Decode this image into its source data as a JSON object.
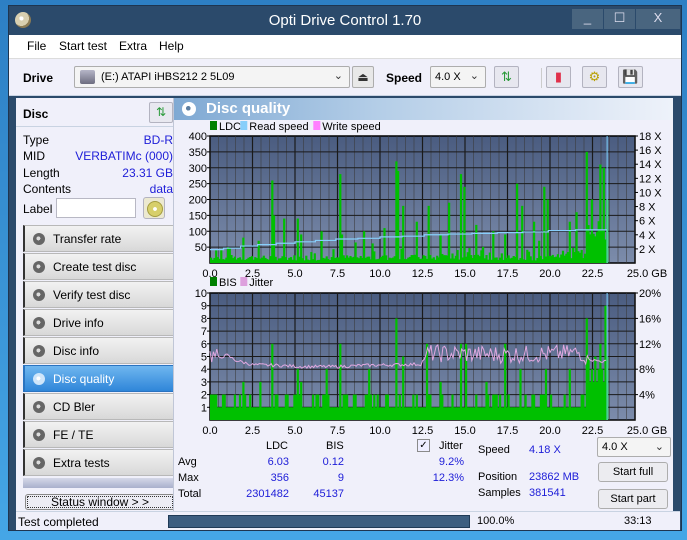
{
  "window": {
    "title": "Opti Drive Control 1.70",
    "controls": [
      "_",
      "☐",
      "X"
    ]
  },
  "menu": [
    {
      "label": "File",
      "accel": "F"
    },
    {
      "label": "Start test",
      "accel": "S"
    },
    {
      "label": "Extra",
      "accel": "x"
    },
    {
      "label": "Help",
      "accel": "H"
    }
  ],
  "toolbar": {
    "drive_label": "Drive",
    "drive_value": "(E:)  ATAPI iHBS212  2 5L09",
    "speed_label": "Speed",
    "speed_value": "4.0 X",
    "icons": [
      "refresh-icon",
      "eraser-icon",
      "settings-icon",
      "save-icon"
    ]
  },
  "disc": {
    "title": "Disc",
    "rows": [
      {
        "key": "Type",
        "value": "BD-R"
      },
      {
        "key": "MID",
        "value": "VERBATIMc (000)"
      },
      {
        "key": "Length",
        "value": "23.31 GB"
      },
      {
        "key": "Contents",
        "value": "data"
      }
    ],
    "label_key": "Label",
    "label_value": ""
  },
  "nav": [
    {
      "label": "Transfer rate",
      "active": false
    },
    {
      "label": "Create test disc",
      "active": false
    },
    {
      "label": "Verify test disc",
      "active": false
    },
    {
      "label": "Drive info",
      "active": false
    },
    {
      "label": "Disc info",
      "active": false
    },
    {
      "label": "Disc quality",
      "active": true
    },
    {
      "label": "CD Bler",
      "active": false
    },
    {
      "label": "FE / TE",
      "active": false
    },
    {
      "label": "Extra tests",
      "active": false
    }
  ],
  "status_window_button": "Status window > >",
  "panel_title": "Disc quality",
  "chart_data": [
    {
      "type": "bar",
      "title": "LDC",
      "legend": [
        "LDC",
        "Read speed",
        "Write speed"
      ],
      "legend_colors": {
        "LDC": "#008000",
        "Read speed": "#87cefa",
        "Write speed": "#ff80ff"
      },
      "xlabel": "GB",
      "x_ticks": [
        "0.0",
        "2.5",
        "5.0",
        "7.5",
        "10.0",
        "12.5",
        "15.0",
        "17.5",
        "20.0",
        "22.5",
        "25.0 GB"
      ],
      "xlim": [
        0,
        25
      ],
      "y_ticks_left": [
        "400",
        "350",
        "300",
        "250",
        "200",
        "150",
        "100",
        "50"
      ],
      "ylim_left": [
        0,
        400
      ],
      "y_ticks_right": [
        "18 X",
        "16 X",
        "14 X",
        "12 X",
        "10 X",
        "8 X",
        "6 X",
        "4 X",
        "2 X"
      ],
      "ylim_right": [
        0,
        18
      ],
      "ldc_peaks": [
        {
          "x": 0.3,
          "y": 40
        },
        {
          "x": 1.0,
          "y": 50
        },
        {
          "x": 1.9,
          "y": 80
        },
        {
          "x": 2.8,
          "y": 70
        },
        {
          "x": 3.6,
          "y": 260
        },
        {
          "x": 3.7,
          "y": 150
        },
        {
          "x": 4.3,
          "y": 140
        },
        {
          "x": 5.1,
          "y": 140
        },
        {
          "x": 5.3,
          "y": 90
        },
        {
          "x": 6.5,
          "y": 100
        },
        {
          "x": 7.6,
          "y": 280
        },
        {
          "x": 7.7,
          "y": 90
        },
        {
          "x": 9.0,
          "y": 100
        },
        {
          "x": 10.2,
          "y": 110
        },
        {
          "x": 10.9,
          "y": 320
        },
        {
          "x": 11.0,
          "y": 290
        },
        {
          "x": 11.3,
          "y": 180
        },
        {
          "x": 12.1,
          "y": 130
        },
        {
          "x": 12.8,
          "y": 180
        },
        {
          "x": 13.5,
          "y": 90
        },
        {
          "x": 14.0,
          "y": 190
        },
        {
          "x": 14.7,
          "y": 280
        },
        {
          "x": 14.9,
          "y": 240
        },
        {
          "x": 15.6,
          "y": 120
        },
        {
          "x": 16.6,
          "y": 100
        },
        {
          "x": 17.3,
          "y": 90
        },
        {
          "x": 18.0,
          "y": 250
        },
        {
          "x": 18.3,
          "y": 180
        },
        {
          "x": 19.0,
          "y": 130
        },
        {
          "x": 19.6,
          "y": 240
        },
        {
          "x": 19.8,
          "y": 200
        },
        {
          "x": 21.1,
          "y": 130
        },
        {
          "x": 21.5,
          "y": 160
        },
        {
          "x": 22.1,
          "y": 350
        },
        {
          "x": 22.4,
          "y": 200
        },
        {
          "x": 22.9,
          "y": 310
        },
        {
          "x": 23.1,
          "y": 300
        },
        {
          "x": 23.3,
          "y": 200
        }
      ],
      "read_speed": [
        {
          "x": 0.0,
          "y": 1.9
        },
        {
          "x": 0.8,
          "y": 2.1
        },
        {
          "x": 1.8,
          "y": 2.4
        },
        {
          "x": 2.8,
          "y": 2.6
        },
        {
          "x": 3.9,
          "y": 2.8
        },
        {
          "x": 5.0,
          "y": 3.0
        },
        {
          "x": 6.2,
          "y": 3.2
        },
        {
          "x": 7.4,
          "y": 3.4
        },
        {
          "x": 8.7,
          "y": 3.5
        },
        {
          "x": 10.0,
          "y": 3.7
        },
        {
          "x": 11.3,
          "y": 3.8
        },
        {
          "x": 12.6,
          "y": 4.0
        },
        {
          "x": 14.0,
          "y": 4.1
        },
        {
          "x": 15.4,
          "y": 4.2
        },
        {
          "x": 16.9,
          "y": 4.3
        },
        {
          "x": 18.4,
          "y": 4.4
        },
        {
          "x": 19.9,
          "y": 4.6
        },
        {
          "x": 21.5,
          "y": 4.7
        },
        {
          "x": 23.3,
          "y": 4.8
        }
      ]
    },
    {
      "type": "bar",
      "title": "BIS",
      "legend": [
        "BIS",
        "Jitter"
      ],
      "legend_colors": {
        "BIS": "#008000",
        "Jitter": "#dda0dd"
      },
      "xlabel": "GB",
      "x_ticks": [
        "0.0",
        "2.5",
        "5.0",
        "7.5",
        "10.0",
        "12.5",
        "15.0",
        "17.5",
        "20.0",
        "22.5",
        "25.0 GB"
      ],
      "xlim": [
        0,
        25
      ],
      "y_ticks_left": [
        "10",
        "9",
        "8",
        "7",
        "6",
        "5",
        "4",
        "3",
        "2",
        "1"
      ],
      "ylim_left": [
        0,
        10
      ],
      "y_ticks_right": [
        "20%",
        "16%",
        "12%",
        "8%",
        "4%"
      ],
      "ylim_right": [
        0,
        20
      ],
      "bis_peaks": [
        {
          "x": 0.8,
          "y": 2
        },
        {
          "x": 1.9,
          "y": 3
        },
        {
          "x": 2.9,
          "y": 3
        },
        {
          "x": 3.6,
          "y": 6
        },
        {
          "x": 4.5,
          "y": 2
        },
        {
          "x": 5.1,
          "y": 4
        },
        {
          "x": 5.3,
          "y": 3
        },
        {
          "x": 6.8,
          "y": 4
        },
        {
          "x": 7.6,
          "y": 6
        },
        {
          "x": 9.3,
          "y": 4
        },
        {
          "x": 10.9,
          "y": 8
        },
        {
          "x": 11.3,
          "y": 5
        },
        {
          "x": 12.7,
          "y": 6
        },
        {
          "x": 13.5,
          "y": 3
        },
        {
          "x": 14.7,
          "y": 6
        },
        {
          "x": 15.0,
          "y": 6
        },
        {
          "x": 16.2,
          "y": 3
        },
        {
          "x": 17.3,
          "y": 6
        },
        {
          "x": 18.2,
          "y": 4
        },
        {
          "x": 19.7,
          "y": 4
        },
        {
          "x": 21.1,
          "y": 4
        },
        {
          "x": 22.1,
          "y": 8
        },
        {
          "x": 22.9,
          "y": 6
        },
        {
          "x": 23.2,
          "y": 9
        }
      ],
      "jitter": [
        {
          "x": 0.0,
          "y": 10.3
        },
        {
          "x": 0.5,
          "y": 9.8
        },
        {
          "x": 1.0,
          "y": 10.2
        },
        {
          "x": 1.5,
          "y": 9.4
        },
        {
          "x": 2.5,
          "y": 8.7
        },
        {
          "x": 4.0,
          "y": 8.6
        },
        {
          "x": 5.5,
          "y": 8.4
        },
        {
          "x": 7.5,
          "y": 8.4
        },
        {
          "x": 9.0,
          "y": 8.6
        },
        {
          "x": 11.0,
          "y": 8.7
        },
        {
          "x": 12.4,
          "y": 8.8
        },
        {
          "x": 12.8,
          "y": 10.5
        },
        {
          "x": 15.0,
          "y": 10.4
        },
        {
          "x": 17.5,
          "y": 10.3
        },
        {
          "x": 20.0,
          "y": 10.4
        },
        {
          "x": 21.8,
          "y": 10.6
        },
        {
          "x": 22.5,
          "y": 9.4
        },
        {
          "x": 23.3,
          "y": 9.2
        }
      ]
    }
  ],
  "stats": {
    "col_ldc": "LDC",
    "col_bis": "BIS",
    "jitter_label": "Jitter",
    "jitter_checked": true,
    "rows": [
      {
        "label": "Avg",
        "ldc": "6.03",
        "bis": "0.12",
        "jitter": "9.2%"
      },
      {
        "label": "Max",
        "ldc": "356",
        "bis": "9",
        "jitter": "12.3%"
      },
      {
        "label": "Total",
        "ldc": "2301482",
        "bis": "45137",
        "jitter": ""
      }
    ],
    "speed_label": "Speed",
    "speed_value": "4.18 X",
    "position_label": "Position",
    "position_value": "23862 MB",
    "samples_label": "Samples",
    "samples_value": "381541",
    "speed_select": "4.0 X",
    "start_full": "Start full",
    "start_part": "Start part"
  },
  "statusbar": {
    "text": "Test completed",
    "progress": 100.0,
    "progress_text": "100.0%",
    "time": "33:13"
  }
}
